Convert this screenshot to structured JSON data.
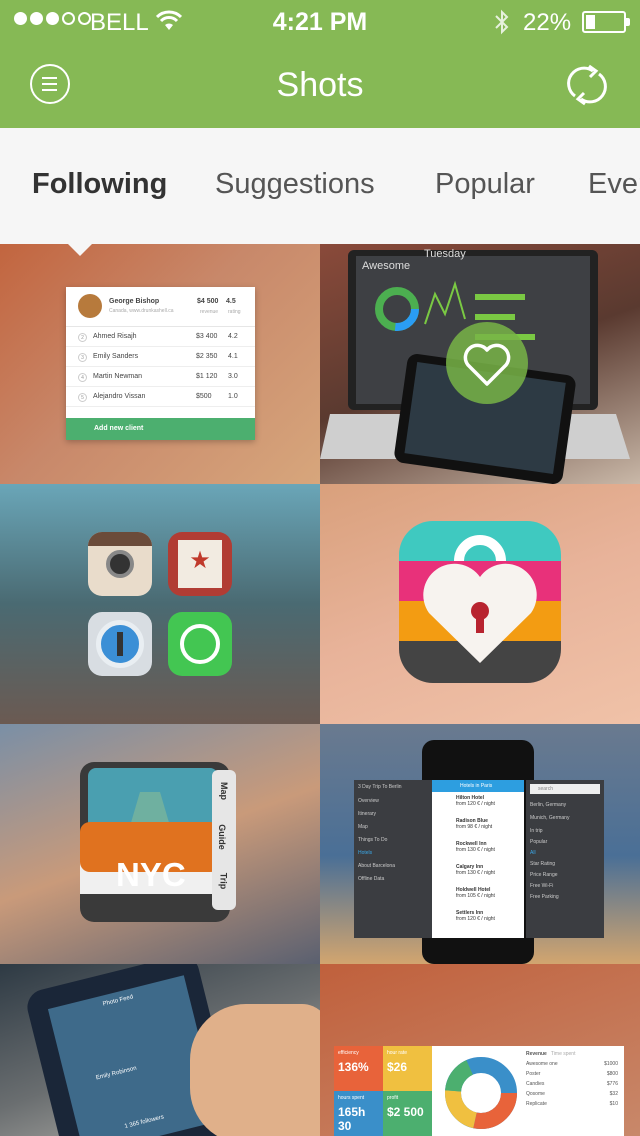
{
  "status_bar": {
    "signal_dots_filled": 3,
    "signal_dots_total": 5,
    "carrier": "BELL",
    "time": "4:21 PM",
    "battery_percent": "22%",
    "battery_level": 0.22
  },
  "nav": {
    "title": "Shots",
    "menu_icon": "menu-icon",
    "refresh_icon": "refresh-icon"
  },
  "tabs": [
    {
      "label": "Following",
      "active": true
    },
    {
      "label": "Suggestions",
      "active": false
    },
    {
      "label": "Popular",
      "active": false
    },
    {
      "label": "Ever",
      "active": false
    }
  ],
  "shots": {
    "client_card": {
      "name": "George Bishop",
      "subtitle": "Canada, www.drunkashell.ca",
      "revenue": "$4 500",
      "revenue_label": "revenue",
      "rating": "4.5",
      "rating_label": "rating",
      "rows": [
        {
          "n": "2",
          "name": "Ahmed Risajh",
          "value": "$3 400",
          "rating": "4.2"
        },
        {
          "n": "3",
          "name": "Emily Sanders",
          "value": "$2 350",
          "rating": "4.1"
        },
        {
          "n": "4",
          "name": "Martin Newman",
          "value": "$1 120",
          "rating": "3.0"
        },
        {
          "n": "5",
          "name": "Alejandro Vissan",
          "value": "$500",
          "rating": "1.0"
        }
      ],
      "add_label": "Add new client"
    },
    "laptop": {
      "screen_title": "Awesome",
      "screen_title_2": "Tuesday",
      "liked_icon": "heart-icon"
    },
    "app_icons": [
      "camera-icon",
      "star-bookmark-icon",
      "lock-key-icon",
      "whatsapp-icon"
    ],
    "lock_app_icon": "heart-lock-icon",
    "nyc": {
      "label": "NYC",
      "tabs": [
        "Map",
        "Guide",
        "Trip"
      ]
    },
    "hotels": {
      "nav_title": "3 Day Trip To Berlin",
      "screen_title": "Hotels in Paris",
      "menu_items": [
        "Overview",
        "Itinerary",
        "Map",
        "Things To Do",
        "Hotels",
        "About Barcelona",
        "Offline Data"
      ],
      "hotels": [
        {
          "name": "Hilton Hotel",
          "price": "from 120 € / night"
        },
        {
          "name": "Radison Blue",
          "price": "from 98 € / night"
        },
        {
          "name": "Rockwell Inn",
          "price": "from 130 € / night"
        },
        {
          "name": "Calgary Inn",
          "price": "from 130 € / night"
        },
        {
          "name": "Holdwell Hotel",
          "price": "from 105 € / night"
        },
        {
          "name": "Settlers Inn",
          "price": "from 120 € / night"
        }
      ],
      "search_placeholder": "search",
      "destinations": [
        "Berlin, Germany",
        "Munich, Germany"
      ],
      "filters": [
        "In trip",
        "Popular",
        "All",
        "Star Rating",
        "Price Range",
        "Free Wi-Fi",
        "Free Parking"
      ]
    },
    "photo_feed": {
      "title": "Photo Feed",
      "user": "Emily Robinson",
      "followers": "1 365 followers"
    },
    "dashboard": {
      "tiles": [
        {
          "label": "efficiency",
          "value": "136%",
          "color": "#e8633a"
        },
        {
          "label": "hour rate",
          "value": "$26",
          "color": "#f0c040"
        },
        {
          "label": "hours spent",
          "value": "165h 30",
          "color": "#3a8fc9"
        },
        {
          "label": "profit",
          "value": "$2 500",
          "color": "#4caf6f"
        }
      ],
      "list_title": "Revenue",
      "list_title_2": "Time spent",
      "list": [
        {
          "name": "Awesome one",
          "value": "$1000"
        },
        {
          "name": "Poster",
          "value": "$800"
        },
        {
          "name": "Candies",
          "value": "$776"
        },
        {
          "name": "Qosome",
          "value": "$32"
        },
        {
          "name": "Replicate",
          "value": "$10"
        }
      ]
    }
  },
  "colors": {
    "accent": "#86b955",
    "tab_bar_bg": "#f6f6f6"
  }
}
